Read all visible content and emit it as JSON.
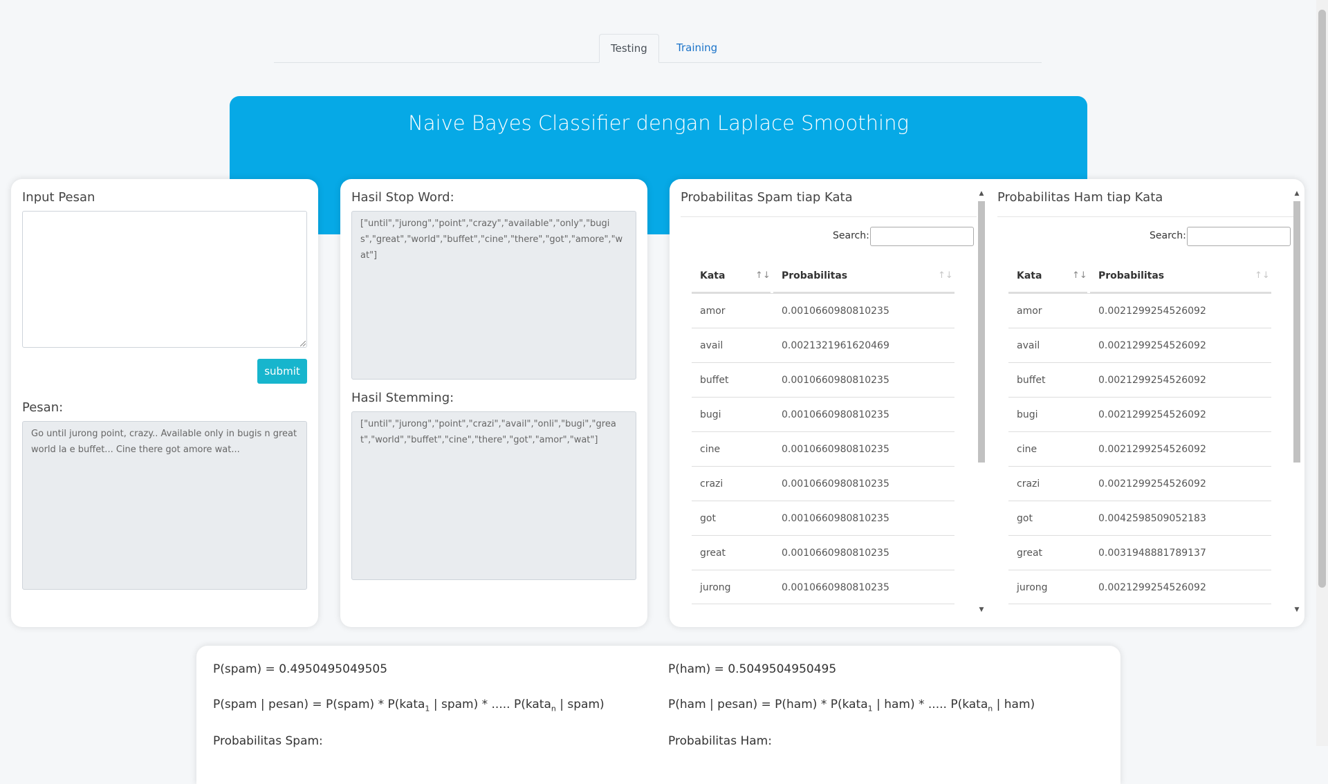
{
  "tabs": [
    {
      "label": "Testing",
      "active": true
    },
    {
      "label": "Training",
      "active": false
    }
  ],
  "banner": {
    "title": "Naive Bayes Classifier dengan Laplace Smoothing",
    "color": "#06a9e6"
  },
  "input_card": {
    "title": "Input Pesan",
    "message_value": "",
    "submit_label": "submit",
    "pesan_label": "Pesan:",
    "pesan_value": "Go until jurong point, crazy.. Available only in bugis n great world la e buffet... Cine there got amore wat..."
  },
  "process_card": {
    "stopword_label": "Hasil Stop Word:",
    "stopword_value": "[\"until\",\"jurong\",\"point\",\"crazy\",\"available\",\"only\",\"bugis\",\"great\",\"world\",\"buffet\",\"cine\",\"there\",\"got\",\"amore\",\"wat\"]",
    "stemming_label": "Hasil Stemming:",
    "stemming_value": "[\"until\",\"jurong\",\"point\",\"crazi\",\"avail\",\"onli\",\"bugi\",\"great\",\"world\",\"buffet\",\"cine\",\"there\",\"got\",\"amor\",\"wat\"]"
  },
  "spam_table": {
    "title": "Probabilitas Spam tiap Kata",
    "search_label": "Search:",
    "columns": [
      "Kata",
      "Probabilitas"
    ],
    "rows": [
      [
        "amor",
        "0.0010660980810235"
      ],
      [
        "avail",
        "0.0021321961620469"
      ],
      [
        "buffet",
        "0.0010660980810235"
      ],
      [
        "bugi",
        "0.0010660980810235"
      ],
      [
        "cine",
        "0.0010660980810235"
      ],
      [
        "crazi",
        "0.0010660980810235"
      ],
      [
        "got",
        "0.0010660980810235"
      ],
      [
        "great",
        "0.0010660980810235"
      ],
      [
        "jurong",
        "0.0010660980810235"
      ]
    ]
  },
  "ham_table": {
    "title": "Probabilitas Ham tiap Kata",
    "search_label": "Search:",
    "columns": [
      "Kata",
      "Probabilitas"
    ],
    "rows": [
      [
        "amor",
        "0.0021299254526092"
      ],
      [
        "avail",
        "0.0021299254526092"
      ],
      [
        "buffet",
        "0.0021299254526092"
      ],
      [
        "bugi",
        "0.0021299254526092"
      ],
      [
        "cine",
        "0.0021299254526092"
      ],
      [
        "crazi",
        "0.0021299254526092"
      ],
      [
        "got",
        "0.0042598509052183"
      ],
      [
        "great",
        "0.0031948881789137"
      ],
      [
        "jurong",
        "0.0021299254526092"
      ]
    ]
  },
  "results": {
    "p_spam": "P(spam) = 0.4950495049505",
    "p_ham": "P(ham) = 0.5049504950495",
    "spam_formula_a": "P(spam | pesan) = P(spam) * P(kata",
    "spam_formula_b": " | spam) * ..... P(kata",
    "spam_formula_c": " | spam)",
    "ham_formula_a": "P(ham | pesan) = P(ham) * P(kata",
    "ham_formula_b": " | ham) * ..... P(kata",
    "ham_formula_c": " | ham)",
    "sub_1": "1",
    "sub_n": "n",
    "prob_spam_label": "Probabilitas Spam:",
    "prob_ham_label": "Probabilitas Ham:"
  }
}
